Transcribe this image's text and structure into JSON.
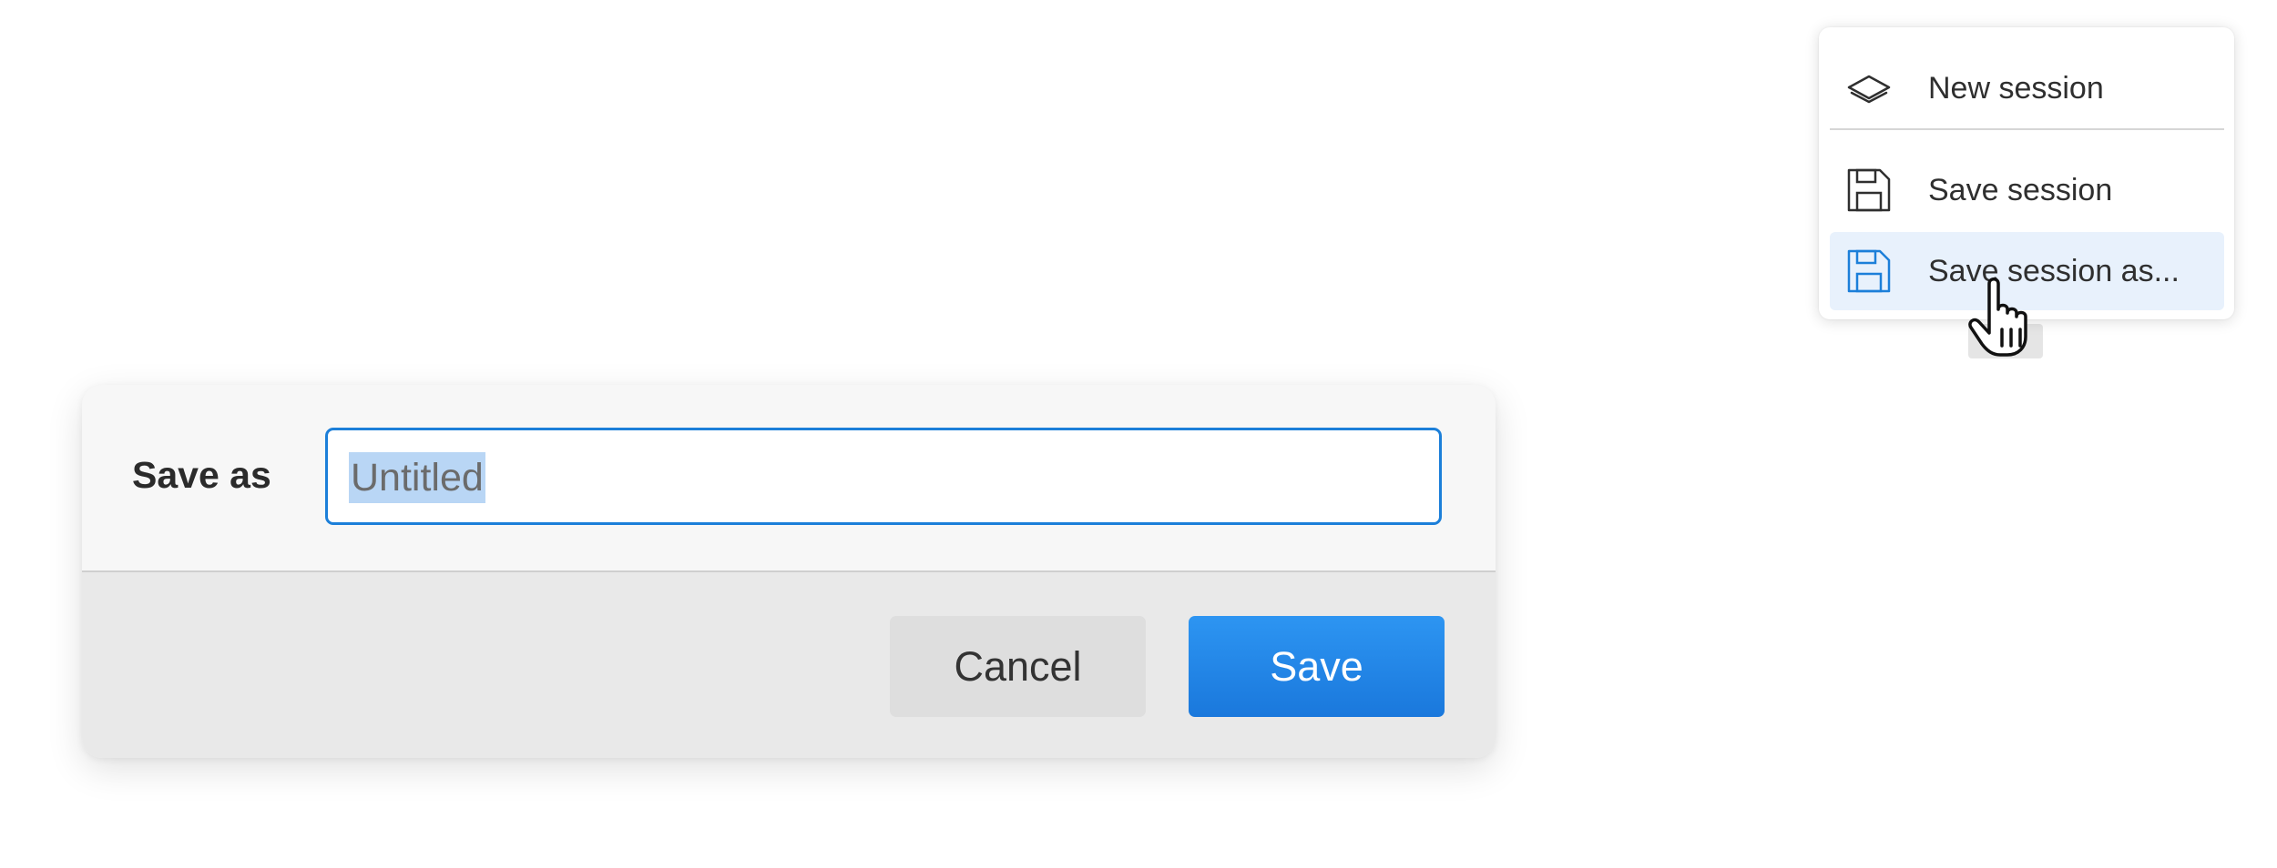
{
  "menu": {
    "items": [
      {
        "label": "New session",
        "icon": "layers-icon"
      },
      {
        "label": "Save session",
        "icon": "floppy-disk-icon"
      },
      {
        "label": "Save session as...",
        "icon": "floppy-disk-icon",
        "highlighted": true
      }
    ],
    "highlight_color": "#e8f1fc",
    "accent_icon_color": "#1c7fd9"
  },
  "dialog": {
    "label": "Save as",
    "input_value": "Untitled",
    "cancel_label": "Cancel",
    "save_label": "Save",
    "primary_color": "#1c7fd9"
  }
}
